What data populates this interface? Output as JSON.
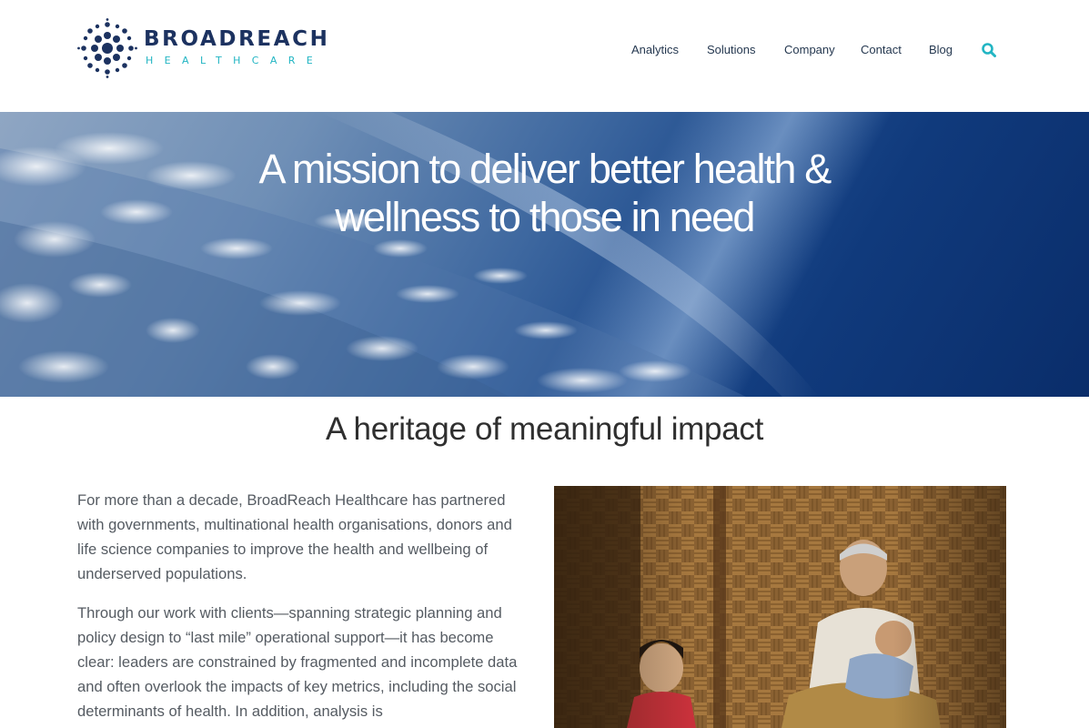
{
  "brand": {
    "name_line1": "BROADREACH",
    "name_line2": "HEALTHCARE",
    "colors": {
      "navy": "#1c3260",
      "teal": "#22b5c3"
    }
  },
  "nav": {
    "items": [
      {
        "label": "Analytics"
      },
      {
        "label": "Solutions"
      },
      {
        "label": "Company"
      },
      {
        "label": "Contact"
      },
      {
        "label": "Blog"
      }
    ],
    "search_icon": "search-icon"
  },
  "hero": {
    "line1": "A mission to deliver better health &",
    "line2": "wellness to those in need",
    "image": "earth-from-space-clouds"
  },
  "section": {
    "title": "A heritage of meaningful impact",
    "paragraphs": [
      "For more than a decade, BroadReach Healthcare has partnered with governments, multinational health organisations, donors and life science companies to improve the health and wellbeing of underserved populations.",
      "Through our work with clients—spanning strategic planning and policy design to “last mile” operational support—it has become clear: leaders are constrained by fragmented and incomplete data and often overlook the impacts of key metrics, including the social determinants of health. In addition, analysis is"
    ],
    "photo": "elder-woman-with-children-bamboo-wall"
  }
}
